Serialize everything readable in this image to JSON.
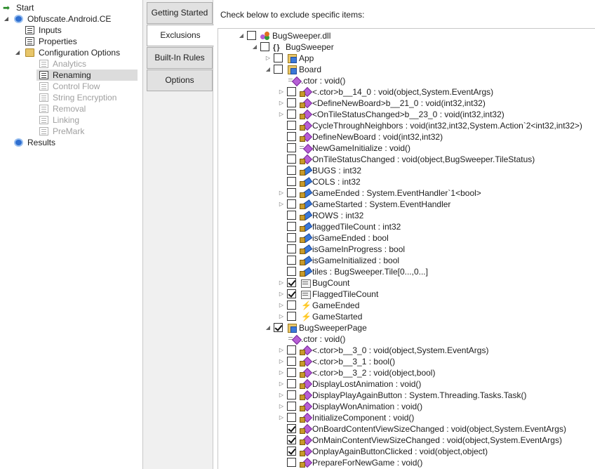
{
  "nav": {
    "items": [
      {
        "label": "Start",
        "icon": "start-arrow-icon",
        "disabled": false,
        "selected": false
      },
      {
        "label": "Obfuscate.Android.CE",
        "icon": "gear-icon",
        "disabled": false,
        "selected": false
      },
      {
        "label": "Inputs",
        "icon": "document-icon",
        "disabled": false,
        "selected": false
      },
      {
        "label": "Properties",
        "icon": "document-icon",
        "disabled": false,
        "selected": false
      },
      {
        "label": "Configuration Options",
        "icon": "folder-icon",
        "disabled": false,
        "selected": false
      },
      {
        "label": "Analytics",
        "icon": "document-icon",
        "disabled": true,
        "selected": false
      },
      {
        "label": "Renaming",
        "icon": "document-icon",
        "disabled": false,
        "selected": true
      },
      {
        "label": "Control Flow",
        "icon": "document-icon",
        "disabled": true,
        "selected": false
      },
      {
        "label": "String Encryption",
        "icon": "document-icon",
        "disabled": true,
        "selected": false
      },
      {
        "label": "Removal",
        "icon": "document-icon",
        "disabled": true,
        "selected": false
      },
      {
        "label": "Linking",
        "icon": "document-icon",
        "disabled": true,
        "selected": false
      },
      {
        "label": "PreMark",
        "icon": "document-icon",
        "disabled": true,
        "selected": false
      },
      {
        "label": "Results",
        "icon": "gear-icon",
        "disabled": false,
        "selected": false
      }
    ]
  },
  "tabs": [
    {
      "label": "Getting Started",
      "active": false
    },
    {
      "label": "Exclusions",
      "active": true
    },
    {
      "label": "Built-In Rules",
      "active": false
    },
    {
      "label": "Options",
      "active": false
    }
  ],
  "main": {
    "hint": "Check below to exclude specific items:",
    "tree": [
      {
        "label": "BugSweeper.dll",
        "icon": "assembly-icon",
        "checked": false,
        "expander": "open",
        "checkbox": true
      },
      {
        "label": "BugSweeper",
        "icon": "namespace-icon",
        "checked": false,
        "expander": "open",
        "checkbox": true
      },
      {
        "label": "App",
        "icon": "class-icon",
        "checked": false,
        "expander": "closed",
        "checkbox": true
      },
      {
        "label": "Board",
        "icon": "class-icon",
        "checked": false,
        "expander": "open",
        "checkbox": true
      },
      {
        "label": ".ctor : void()",
        "icon": "constructor-icon",
        "checked": false,
        "expander": "none",
        "checkbox": false
      },
      {
        "label": "<.ctor>b__14_0 : void(object,System.EventArgs)",
        "icon": "private-method-icon",
        "checked": false,
        "expander": "closed",
        "checkbox": true
      },
      {
        "label": "<DefineNewBoard>b__21_0 : void(int32,int32)",
        "icon": "private-method-icon",
        "checked": false,
        "expander": "closed",
        "checkbox": true
      },
      {
        "label": "<OnTileStatusChanged>b__23_0 : void(int32,int32)",
        "icon": "private-method-icon",
        "checked": false,
        "expander": "closed",
        "checkbox": true
      },
      {
        "label": "CycleThroughNeighbors : void(int32,int32,System.Action`2<int32,int32>)",
        "icon": "private-method-icon",
        "checked": false,
        "expander": "none",
        "checkbox": true
      },
      {
        "label": "DefineNewBoard : void(int32,int32)",
        "icon": "private-method-icon",
        "checked": false,
        "expander": "none",
        "checkbox": true
      },
      {
        "label": "NewGameInitialize : void()",
        "icon": "constructor-icon",
        "checked": false,
        "expander": "none",
        "checkbox": true
      },
      {
        "label": "OnTileStatusChanged : void(object,BugSweeper.TileStatus)",
        "icon": "private-method-icon",
        "checked": false,
        "expander": "none",
        "checkbox": true
      },
      {
        "label": "BUGS : int32",
        "icon": "private-field-icon",
        "checked": false,
        "expander": "none",
        "checkbox": true
      },
      {
        "label": "COLS : int32",
        "icon": "private-field-icon",
        "checked": false,
        "expander": "none",
        "checkbox": true
      },
      {
        "label": "GameEnded : System.EventHandler`1<bool>",
        "icon": "private-field-icon",
        "checked": false,
        "expander": "closed",
        "checkbox": true
      },
      {
        "label": "GameStarted : System.EventHandler",
        "icon": "private-field-icon",
        "checked": false,
        "expander": "closed",
        "checkbox": true
      },
      {
        "label": "ROWS : int32",
        "icon": "private-field-icon",
        "checked": false,
        "expander": "none",
        "checkbox": true
      },
      {
        "label": "flaggedTileCount : int32",
        "icon": "private-field-icon",
        "checked": false,
        "expander": "none",
        "checkbox": true
      },
      {
        "label": "isGameEnded : bool",
        "icon": "private-field-icon",
        "checked": false,
        "expander": "none",
        "checkbox": true
      },
      {
        "label": "isGameInProgress : bool",
        "icon": "private-field-icon",
        "checked": false,
        "expander": "none",
        "checkbox": true
      },
      {
        "label": "isGameInitialized : bool",
        "icon": "private-field-icon",
        "checked": false,
        "expander": "none",
        "checkbox": true
      },
      {
        "label": "tiles : BugSweeper.Tile[0...,0...]",
        "icon": "private-field-icon",
        "checked": false,
        "expander": "none",
        "checkbox": true
      },
      {
        "label": "BugCount",
        "icon": "property-icon",
        "checked": true,
        "expander": "closed",
        "checkbox": true
      },
      {
        "label": "FlaggedTileCount",
        "icon": "property-icon",
        "checked": true,
        "expander": "closed",
        "checkbox": true
      },
      {
        "label": "GameEnded",
        "icon": "event-icon",
        "checked": false,
        "expander": "closed",
        "checkbox": true
      },
      {
        "label": "GameStarted",
        "icon": "event-icon",
        "checked": false,
        "expander": "closed",
        "checkbox": true
      },
      {
        "label": "BugSweeperPage",
        "icon": "class-icon",
        "checked": true,
        "expander": "open",
        "checkbox": true
      },
      {
        "label": ".ctor : void()",
        "icon": "constructor-icon",
        "checked": false,
        "expander": "none",
        "checkbox": false
      },
      {
        "label": "<.ctor>b__3_0 : void(object,System.EventArgs)",
        "icon": "private-method-icon",
        "checked": false,
        "expander": "closed",
        "checkbox": true
      },
      {
        "label": "<.ctor>b__3_1 : bool()",
        "icon": "private-method-icon",
        "checked": false,
        "expander": "closed",
        "checkbox": true
      },
      {
        "label": "<.ctor>b__3_2 : void(object,bool)",
        "icon": "private-method-icon",
        "checked": false,
        "expander": "closed",
        "checkbox": true
      },
      {
        "label": "DisplayLostAnimation : void()",
        "icon": "private-method-icon",
        "checked": false,
        "expander": "closed",
        "checkbox": true
      },
      {
        "label": "DisplayPlayAgainButton : System.Threading.Tasks.Task()",
        "icon": "private-method-icon",
        "checked": false,
        "expander": "closed",
        "checkbox": true
      },
      {
        "label": "DisplayWonAnimation : void()",
        "icon": "private-method-icon",
        "checked": false,
        "expander": "closed",
        "checkbox": true
      },
      {
        "label": "InitializeComponent : void()",
        "icon": "private-method-icon",
        "checked": false,
        "expander": "closed",
        "checkbox": true
      },
      {
        "label": "OnBoardContentViewSizeChanged : void(object,System.EventArgs)",
        "icon": "private-method-icon",
        "checked": true,
        "expander": "none",
        "checkbox": true
      },
      {
        "label": "OnMainContentViewSizeChanged : void(object,System.EventArgs)",
        "icon": "private-method-icon",
        "checked": true,
        "expander": "none",
        "checkbox": true
      },
      {
        "label": "OnplayAgainButtonClicked : void(object,object)",
        "icon": "private-method-icon",
        "checked": true,
        "expander": "none",
        "checkbox": true
      },
      {
        "label": "PrepareForNewGame : void()",
        "icon": "private-method-icon",
        "checked": false,
        "expander": "none",
        "checkbox": true
      }
    ]
  }
}
